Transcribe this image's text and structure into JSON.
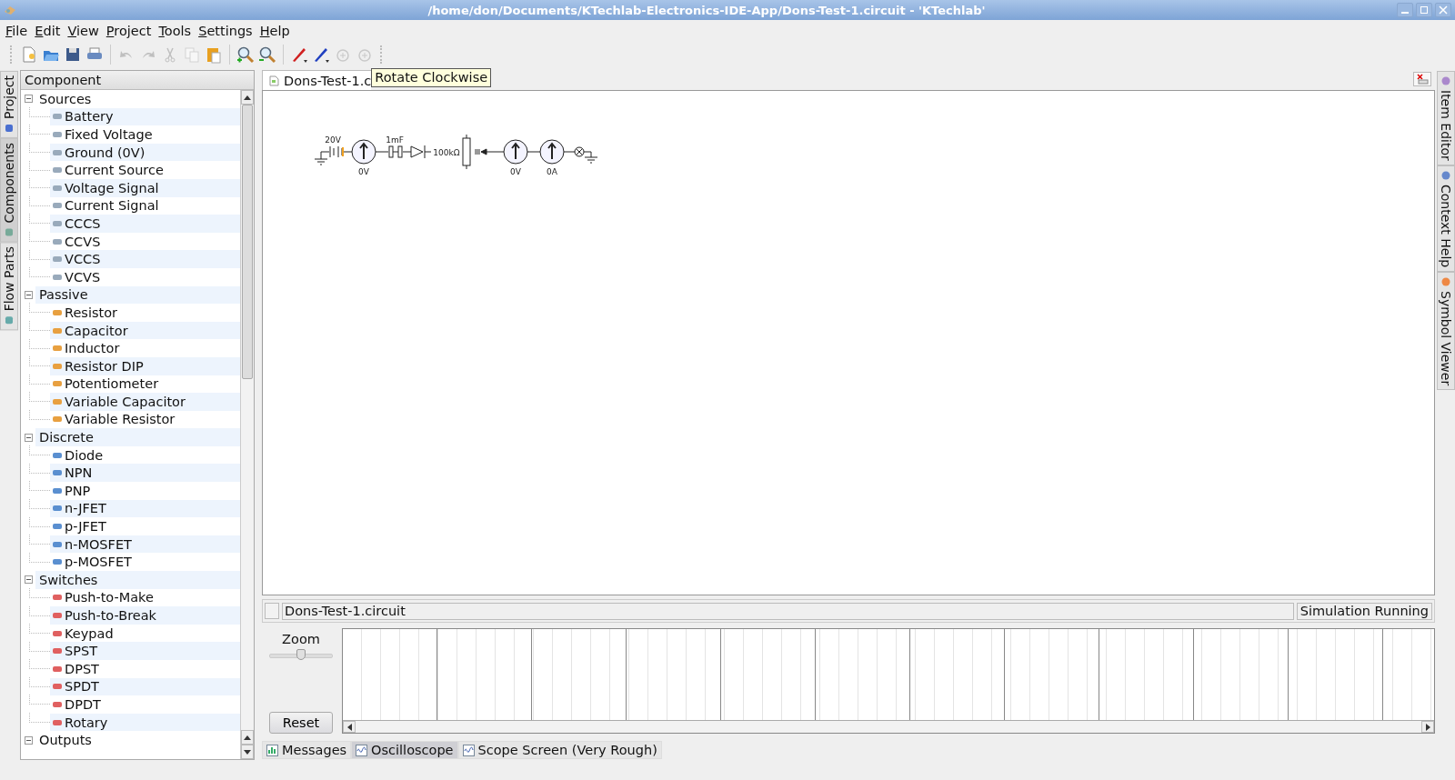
{
  "window": {
    "title": "/home/don/Documents/KTechlab-Electronics-IDE-App/Dons-Test-1.circuit - 'KTechlab'"
  },
  "menu": [
    "File",
    "Edit",
    "View",
    "Project",
    "Tools",
    "Settings",
    "Help"
  ],
  "toolbar": [
    {
      "kind": "new",
      "disabled": false
    },
    {
      "kind": "open",
      "disabled": false
    },
    {
      "kind": "save",
      "disabled": false
    },
    {
      "kind": "print",
      "disabled": false
    },
    {
      "kind": "separator"
    },
    {
      "kind": "undo",
      "disabled": true
    },
    {
      "kind": "redo",
      "disabled": true
    },
    {
      "kind": "cut",
      "disabled": true
    },
    {
      "kind": "copy",
      "disabled": true
    },
    {
      "kind": "paste",
      "disabled": false
    },
    {
      "kind": "separator"
    },
    {
      "kind": "zoom-in",
      "disabled": false
    },
    {
      "kind": "zoom-out",
      "disabled": false
    },
    {
      "kind": "separator"
    },
    {
      "kind": "pen-red",
      "disabled": false
    },
    {
      "kind": "pen-blue",
      "disabled": false
    },
    {
      "kind": "rotate-ccw",
      "disabled": true
    },
    {
      "kind": "rotate-cw",
      "disabled": true
    }
  ],
  "left_tabs": [
    {
      "label": "Project",
      "selected": false
    },
    {
      "label": "Components",
      "selected": true
    },
    {
      "label": "Flow Parts",
      "selected": false
    }
  ],
  "right_tabs": [
    {
      "label": "Item Editor",
      "selected": false
    },
    {
      "label": "Context Help",
      "selected": false
    },
    {
      "label": "Symbol Viewer",
      "selected": false
    }
  ],
  "tree": {
    "header": "Component",
    "items": [
      {
        "label": "Sources",
        "expanded": true,
        "children": [
          "Battery",
          "Fixed Voltage",
          "Ground (0V)",
          "Current Source",
          "Voltage Signal",
          "Current Signal",
          "CCCS",
          "CCVS",
          "VCCS",
          "VCVS"
        ]
      },
      {
        "label": "Passive",
        "expanded": true,
        "children": [
          "Resistor",
          "Capacitor",
          "Inductor",
          "Resistor DIP",
          "Potentiometer",
          "Variable Capacitor",
          "Variable Resistor"
        ]
      },
      {
        "label": "Discrete",
        "expanded": true,
        "children": [
          "Diode",
          "NPN",
          "PNP",
          "n-JFET",
          "p-JFET",
          "n-MOSFET",
          "p-MOSFET"
        ]
      },
      {
        "label": "Switches",
        "expanded": true,
        "children": [
          "Push-to-Make",
          "Push-to-Break",
          "Keypad",
          "SPST",
          "DPST",
          "SPDT",
          "DPDT",
          "Rotary"
        ]
      },
      {
        "label": "Outputs",
        "expanded": true
      }
    ]
  },
  "document_tab": {
    "label": "Dons-Test-1.c"
  },
  "tooltip": "Rotate Clockwise",
  "circuit": {
    "labels": [
      "20V",
      "0V",
      "1mF",
      "100kΩ",
      "0V",
      "0A"
    ]
  },
  "status": {
    "file": "Dons-Test-1.circuit",
    "state": "Simulation Running"
  },
  "oscilloscope": {
    "zoom_label": "Zoom",
    "zoom": {
      "level": 0.5
    },
    "reset": "Reset"
  },
  "bottom_tabs": [
    {
      "label": "Messages",
      "selected": false
    },
    {
      "label": "Oscilloscope",
      "selected": true
    },
    {
      "label": "Scope Screen (Very Rough)",
      "selected": false
    }
  ]
}
